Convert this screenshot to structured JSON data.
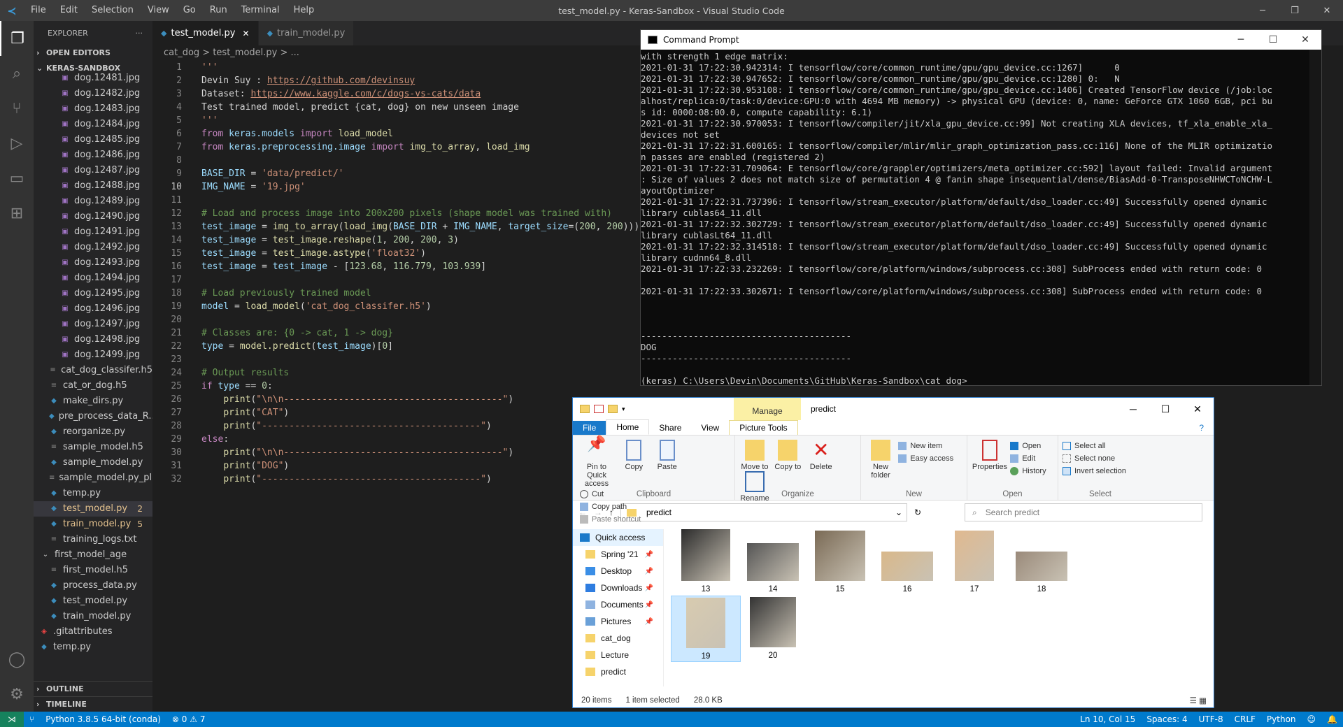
{
  "titlebar": {
    "menu": [
      "File",
      "Edit",
      "Selection",
      "View",
      "Go",
      "Run",
      "Terminal",
      "Help"
    ],
    "title": "test_model.py - Keras-Sandbox - Visual Studio Code"
  },
  "sidebar": {
    "title": "EXPLORER",
    "open_editors": "OPEN EDITORS",
    "project": "KERAS-SANDBOX",
    "files": [
      {
        "name": "dog.12481.jpg",
        "icon": "image"
      },
      {
        "name": "dog.12482.jpg",
        "icon": "image"
      },
      {
        "name": "dog.12483.jpg",
        "icon": "image"
      },
      {
        "name": "dog.12484.jpg",
        "icon": "image"
      },
      {
        "name": "dog.12485.jpg",
        "icon": "image"
      },
      {
        "name": "dog.12486.jpg",
        "icon": "image"
      },
      {
        "name": "dog.12487.jpg",
        "icon": "image"
      },
      {
        "name": "dog.12488.jpg",
        "icon": "image"
      },
      {
        "name": "dog.12489.jpg",
        "icon": "image"
      },
      {
        "name": "dog.12490.jpg",
        "icon": "image"
      },
      {
        "name": "dog.12491.jpg",
        "icon": "image"
      },
      {
        "name": "dog.12492.jpg",
        "icon": "image"
      },
      {
        "name": "dog.12493.jpg",
        "icon": "image"
      },
      {
        "name": "dog.12494.jpg",
        "icon": "image"
      },
      {
        "name": "dog.12495.jpg",
        "icon": "image"
      },
      {
        "name": "dog.12496.jpg",
        "icon": "image"
      },
      {
        "name": "dog.12497.jpg",
        "icon": "image"
      },
      {
        "name": "dog.12498.jpg",
        "icon": "image"
      },
      {
        "name": "dog.12499.jpg",
        "icon": "image"
      },
      {
        "name": "cat_dog_classifer.h5",
        "icon": "file",
        "indent": 1
      },
      {
        "name": "cat_or_dog.h5",
        "icon": "file",
        "indent": 1
      },
      {
        "name": "make_dirs.py",
        "icon": "python",
        "indent": 1
      },
      {
        "name": "pre_process_data_R...",
        "icon": "python",
        "indent": 1
      },
      {
        "name": "reorganize.py",
        "icon": "python",
        "indent": 1
      },
      {
        "name": "sample_model.h5",
        "icon": "file",
        "indent": 1
      },
      {
        "name": "sample_model.py",
        "icon": "python",
        "indent": 1
      },
      {
        "name": "sample_model.py_pl...",
        "icon": "file",
        "indent": 1
      },
      {
        "name": "temp.py",
        "icon": "python",
        "indent": 1
      },
      {
        "name": "test_model.py",
        "icon": "python",
        "indent": 1,
        "badge": "2",
        "modified": true,
        "selected": true
      },
      {
        "name": "train_model.py",
        "icon": "python",
        "indent": 1,
        "badge": "5",
        "modified": true
      },
      {
        "name": "training_logs.txt",
        "icon": "text",
        "indent": 1
      },
      {
        "name": "first_model_age",
        "icon": "folder",
        "indent": 0
      },
      {
        "name": "first_model.h5",
        "icon": "file",
        "indent": 1
      },
      {
        "name": "process_data.py",
        "icon": "python",
        "indent": 1
      },
      {
        "name": "test_model.py",
        "icon": "python",
        "indent": 1
      },
      {
        "name": "train_model.py",
        "icon": "python",
        "indent": 1
      },
      {
        "name": ".gitattributes",
        "icon": "git",
        "indent": 0
      },
      {
        "name": "temp.py",
        "icon": "python",
        "indent": 0
      }
    ],
    "outline": "OUTLINE",
    "timeline": "TIMELINE"
  },
  "editor": {
    "tabs": [
      {
        "label": "test_model.py",
        "active": true
      },
      {
        "label": "train_model.py",
        "active": false
      }
    ],
    "breadcrumb": "cat_dog  >  test_model.py  >  ...",
    "current_line": 10
  },
  "code_lines": [
    "'''",
    "Devin Suy : https://github.com/devinsuy",
    "Dataset: https://www.kaggle.com/c/dogs-vs-cats/data",
    "Test trained model, predict {cat, dog} on new unseen image",
    "'''",
    "from keras.models import load_model",
    "from keras.preprocessing.image import img_to_array, load_img",
    "",
    "BASE_DIR = 'data/predict/'",
    "IMG_NAME = '19.jpg'",
    "",
    "# Load and process image into 200x200 pixels (shape model was trained with)",
    "test_image = img_to_array(load_img(BASE_DIR + IMG_NAME, target_size=(200, 200)))",
    "test_image = test_image.reshape(1, 200, 200, 3)",
    "test_image = test_image.astype('float32')",
    "test_image = test_image - [123.68, 116.779, 103.939]",
    "",
    "# Load previously trained model",
    "model = load_model('cat_dog_classifer.h5')",
    "",
    "# Classes are: {0 -> cat, 1 -> dog}",
    "type = model.predict(test_image)[0]",
    "",
    "# Output results",
    "if type == 0:",
    "    print(\"\\n\\n----------------------------------------\")",
    "    print(\"CAT\")",
    "    print(\"----------------------------------------\")",
    "else:",
    "    print(\"\\n\\n----------------------------------------\")",
    "    print(\"DOG\")",
    "    print(\"----------------------------------------\")"
  ],
  "cmd": {
    "title": "Command Prompt",
    "text": "with strength 1 edge matrix:\n2021-01-31 17:22:30.942314: I tensorflow/core/common_runtime/gpu/gpu_device.cc:1267]      0\n2021-01-31 17:22:30.947652: I tensorflow/core/common_runtime/gpu/gpu_device.cc:1280] 0:   N\n2021-01-31 17:22:30.953108: I tensorflow/core/common_runtime/gpu/gpu_device.cc:1406] Created TensorFlow device (/job:loc\nalhost/replica:0/task:0/device:GPU:0 with 4694 MB memory) -> physical GPU (device: 0, name: GeForce GTX 1060 6GB, pci bu\ns id: 0000:08:00.0, compute capability: 6.1)\n2021-01-31 17:22:30.970053: I tensorflow/compiler/jit/xla_gpu_device.cc:99] Not creating XLA devices, tf_xla_enable_xla_\ndevices not set\n2021-01-31 17:22:31.600165: I tensorflow/compiler/mlir/mlir_graph_optimization_pass.cc:116] None of the MLIR optimizatio\nn passes are enabled (registered 2)\n2021-01-31 17:22:31.709064: E tensorflow/core/grappler/optimizers/meta_optimizer.cc:592] layout failed: Invalid argument\n: Size of values 2 does not match size of permutation 4 @ fanin shape insequential/dense/BiasAdd-0-TransposeNHWCToNCHW-L\nayoutOptimizer\n2021-01-31 17:22:31.737396: I tensorflow/stream_executor/platform/default/dso_loader.cc:49] Successfully opened dynamic\nlibrary cublas64_11.dll\n2021-01-31 17:22:32.302729: I tensorflow/stream_executor/platform/default/dso_loader.cc:49] Successfully opened dynamic\nlibrary cublasLt64_11.dll\n2021-01-31 17:22:32.314518: I tensorflow/stream_executor/platform/default/dso_loader.cc:49] Successfully opened dynamic\nlibrary cudnn64_8.dll\n2021-01-31 17:22:33.232269: I tensorflow/core/platform/windows/subprocess.cc:308] SubProcess ended with return code: 0\n\n2021-01-31 17:22:33.302671: I tensorflow/core/platform/windows/subprocess.cc:308] SubProcess ended with return code: 0\n\n\n\n----------------------------------------\nDOG\n----------------------------------------\n\n(keras) C:\\Users\\Devin\\Documents\\GitHub\\Keras-Sandbox\\cat_dog>_"
  },
  "explorer": {
    "title": "predict",
    "manage": "Manage",
    "tabs": {
      "file": "File",
      "home": "Home",
      "share": "Share",
      "view": "View",
      "picture_tools": "Picture Tools"
    },
    "clipboard": {
      "pin": "Pin to Quick access",
      "copy": "Copy",
      "paste": "Paste",
      "cut": "Cut",
      "copy_path": "Copy path",
      "paste_shortcut": "Paste shortcut",
      "label": "Clipboard"
    },
    "organize": {
      "move_to": "Move to",
      "copy_to": "Copy to",
      "delete": "Delete",
      "rename": "Rename",
      "label": "Organize"
    },
    "new": {
      "new_folder": "New folder",
      "new_item": "New item",
      "easy_access": "Easy access",
      "label": "New"
    },
    "open": {
      "properties": "Properties",
      "open": "Open",
      "edit": "Edit",
      "history": "History",
      "label": "Open"
    },
    "select": {
      "select_all": "Select all",
      "select_none": "Select none",
      "invert": "Invert selection",
      "label": "Select"
    },
    "address": "predict",
    "search_placeholder": "Search predict",
    "nav": [
      {
        "label": "Quick access",
        "qa": true
      },
      {
        "label": "Spring '21",
        "pin": true
      },
      {
        "label": "Desktop",
        "pin": true
      },
      {
        "label": "Downloads",
        "pin": true
      },
      {
        "label": "Documents",
        "pin": true
      },
      {
        "label": "Pictures",
        "pin": true
      },
      {
        "label": "cat_dog"
      },
      {
        "label": "Lecture"
      },
      {
        "label": "predict"
      }
    ],
    "thumbs": [
      {
        "label": "13"
      },
      {
        "label": "14"
      },
      {
        "label": "15"
      },
      {
        "label": "16"
      },
      {
        "label": "17"
      },
      {
        "label": "18"
      },
      {
        "label": "19",
        "selected": true
      },
      {
        "label": "20"
      }
    ],
    "status_items": "20 items",
    "status_selected": "1 item selected",
    "status_size": "28.0 KB"
  },
  "status": {
    "python": "Python 3.8.5 64-bit (conda)",
    "problems": "⊗ 0 ⚠ 7",
    "position": "Ln 10, Col 15",
    "spaces": "Spaces: 4",
    "encoding": "UTF-8",
    "eol": "CRLF",
    "lang": "Python"
  }
}
